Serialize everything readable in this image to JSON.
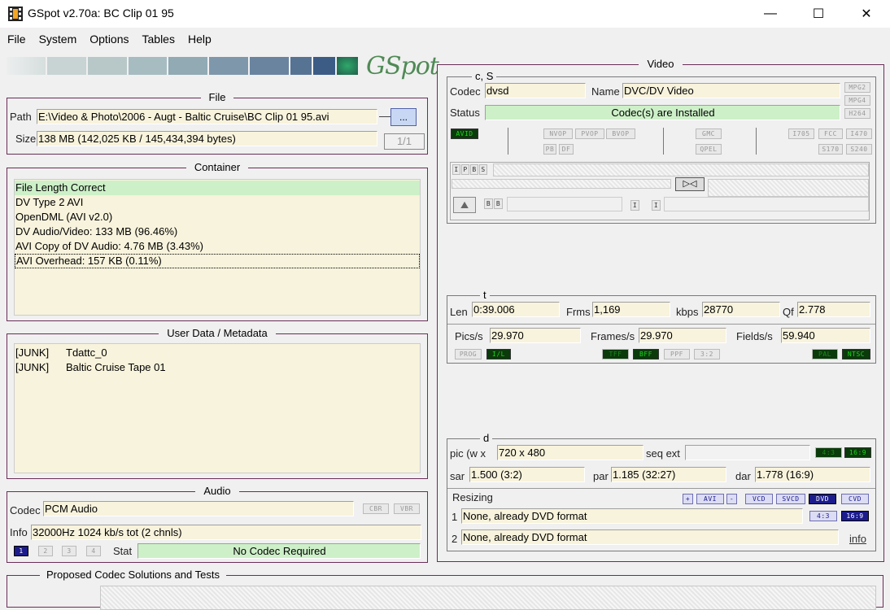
{
  "window": {
    "title": "GSpot v2.70a: BC Clip 01 95",
    "minimize": "—",
    "maximize": "☐",
    "close": "✕"
  },
  "menu": [
    "File",
    "System",
    "Options",
    "Tables",
    "Help"
  ],
  "logo_text": "GSpot",
  "file": {
    "title": "File",
    "path_label": "Path",
    "path": "E:\\Video & Photo\\2006 - Augt - Baltic Cruise\\BC Clip 01 95.avi",
    "browse": "...",
    "size_label": "Size",
    "size": "138 MB (142,025 KB / 145,434,394 bytes)",
    "page": "1/1"
  },
  "container": {
    "title": "Container",
    "items": [
      "File Length Correct",
      "DV Type 2 AVI",
      "OpenDML (AVI v2.0)",
      "DV Audio/Video: 133 MB (96.46%)",
      "AVI Copy of DV Audio: 4.76 MB (3.43%)",
      "AVI Overhead: 157 KB (0.11%)"
    ]
  },
  "metadata": {
    "title": "User Data / Metadata",
    "rows": [
      {
        "tag": "[JUNK]",
        "value": "Tdattc_0"
      },
      {
        "tag": "[JUNK]",
        "value": "Baltic Cruise Tape 01"
      }
    ]
  },
  "audio": {
    "title": "Audio",
    "codec_label": "Codec",
    "codec": "PCM Audio",
    "cbr": "CBR",
    "vbr": "VBR",
    "info_label": "Info",
    "info": "32000Hz  1024 kb/s tot (2 chnls)",
    "streams": [
      "1",
      "2",
      "3",
      "4"
    ],
    "stat_label": "Stat",
    "stat": "No Codec Required"
  },
  "codecs": {
    "title": "Proposed Codec Solutions and Tests"
  },
  "video": {
    "title": "Video",
    "cs_title": "c, S",
    "codec_label": "Codec",
    "codec": "dvsd",
    "name_label": "Name",
    "name": "DVC/DV Video",
    "status_label": "Status",
    "status": "Codec(s) are Installed",
    "side_flags": [
      "MPG2",
      "MPG4",
      "H264"
    ],
    "flags": {
      "avid": "AVID",
      "nvop": "NVOP",
      "pvop": "PVOP",
      "bvop": "BVOP",
      "pb": "PB",
      "df": "DF",
      "gmc": "GMC",
      "qpel": "QPEL",
      "i705": "I705",
      "fcc": "FCC",
      "i470": "I470",
      "s170": "S170",
      "s240": "S240"
    },
    "frame_types": [
      "I",
      "P",
      "B",
      "S"
    ],
    "bb": [
      "B",
      "B"
    ],
    "ii": [
      "I",
      "I"
    ],
    "t_title": "t",
    "len_label": "Len",
    "len": "0:39.006",
    "frms_label": "Frms",
    "frms": "1,169",
    "kbps_label": "kbps",
    "kbps": "28770",
    "qf_label": "Qf",
    "qf": "2.778",
    "pics_label": "Pics/s",
    "pics": "29.970",
    "frames_label": "Frames/s",
    "frames": "29.970",
    "fields_label": "Fields/s",
    "fields": "59.940",
    "scan_flags": {
      "prog": "PROG",
      "il": "I/L",
      "tff": "TFF",
      "bff": "BFF",
      "ppf": "PPF",
      "p32": "3:2",
      "pal": "PAL",
      "ntsc": "NTSC"
    },
    "d_title": "d",
    "pic_label": "pic (w x",
    "pic": "720 x 480",
    "seqext_label": "seq ext",
    "seqext": "",
    "ar43": "4:3",
    "ar169": "16:9",
    "sar_label": "sar",
    "sar": "1.500 (3:2)",
    "par_label": "par",
    "par": "1.185 (32:27)",
    "dar_label": "dar",
    "dar": "1.778 (16:9)",
    "resizing_label": "Resizing",
    "resize_buttons": {
      "plus": "+",
      "avi": "AVI",
      "minus": "-",
      "vcd": "VCD",
      "svcd": "SVCD",
      "dvd": "DVD",
      "cvd": "CVD"
    },
    "res1_label": "1",
    "res1": "None, already DVD format",
    "res2_label": "2",
    "res2": "None, already DVD format",
    "res_ar43": "4:3",
    "res_ar169": "16:9",
    "info_link": "info"
  }
}
